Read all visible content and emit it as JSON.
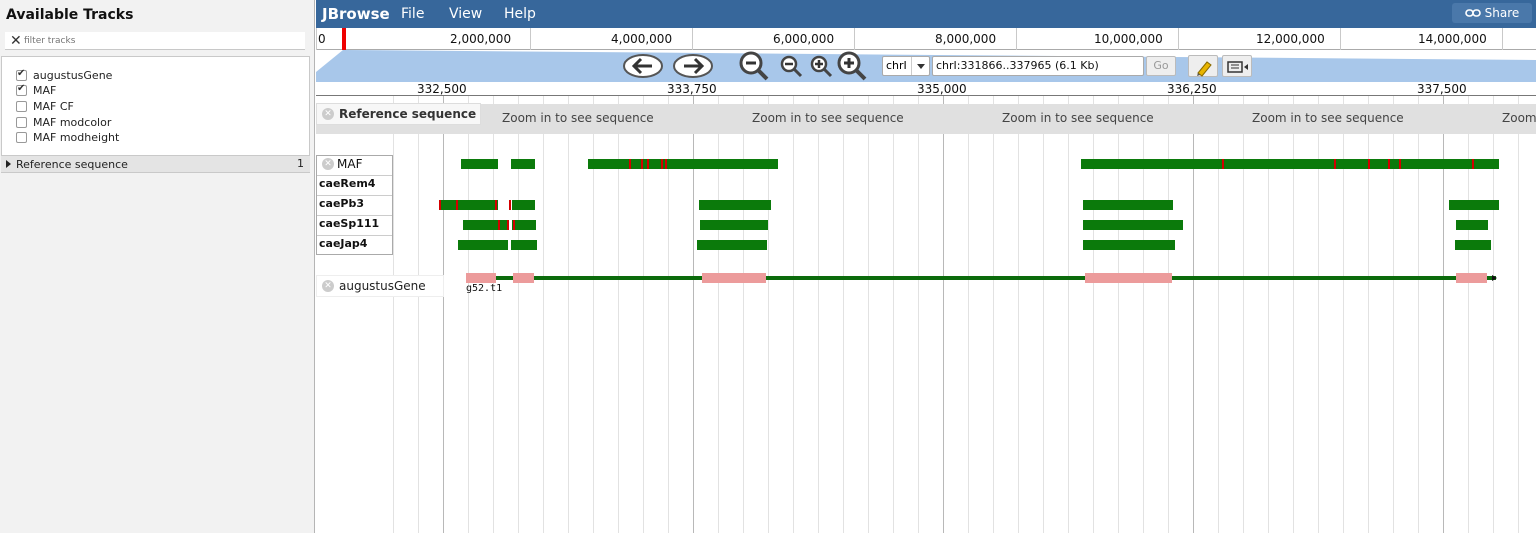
{
  "left_panel": {
    "title": "Available Tracks",
    "filter_placeholder": "filter tracks",
    "tracks": [
      {
        "label": "augustusGene",
        "checked": true
      },
      {
        "label": "MAF",
        "checked": true
      },
      {
        "label": "MAF CF",
        "checked": false
      },
      {
        "label": "MAF modcolor",
        "checked": false
      },
      {
        "label": "MAF modheight",
        "checked": false
      }
    ],
    "category": {
      "label": "Reference sequence",
      "count": "1"
    }
  },
  "menubar": {
    "brand": "JBrowse",
    "items": [
      "File",
      "View",
      "Help"
    ],
    "share_label": "Share"
  },
  "overview": {
    "ticks": [
      "0",
      "2,000,000",
      "4,000,000",
      "6,000,000",
      "8,000,000",
      "10,000,000",
      "12,000,000",
      "14,000,000"
    ]
  },
  "nav": {
    "chromosome": "chrI",
    "location": "chrI:331866..337965 (6.1 Kb)",
    "go_label": "Go"
  },
  "ruler": {
    "ticks": [
      "332,500",
      "333,750",
      "335,000",
      "336,250",
      "337,500"
    ]
  },
  "tracks": {
    "reference": {
      "label": "Reference sequence",
      "zoom_message": "Zoom in to see sequence"
    },
    "maf": {
      "label": "MAF",
      "species": [
        "caeRem4",
        "caePb3",
        "caeSp111",
        "caeJap4"
      ]
    },
    "augustus": {
      "label": "augustusGene",
      "feature_name": "g52.t1"
    }
  },
  "colors": {
    "menubar": "#37679b",
    "maf_green": "#0b7a0b",
    "mismatch_red": "#d40000",
    "exon_pink": "#ec9b9b",
    "intron_green": "#0b6b0b",
    "overview_fill": "#a8c7ea"
  }
}
